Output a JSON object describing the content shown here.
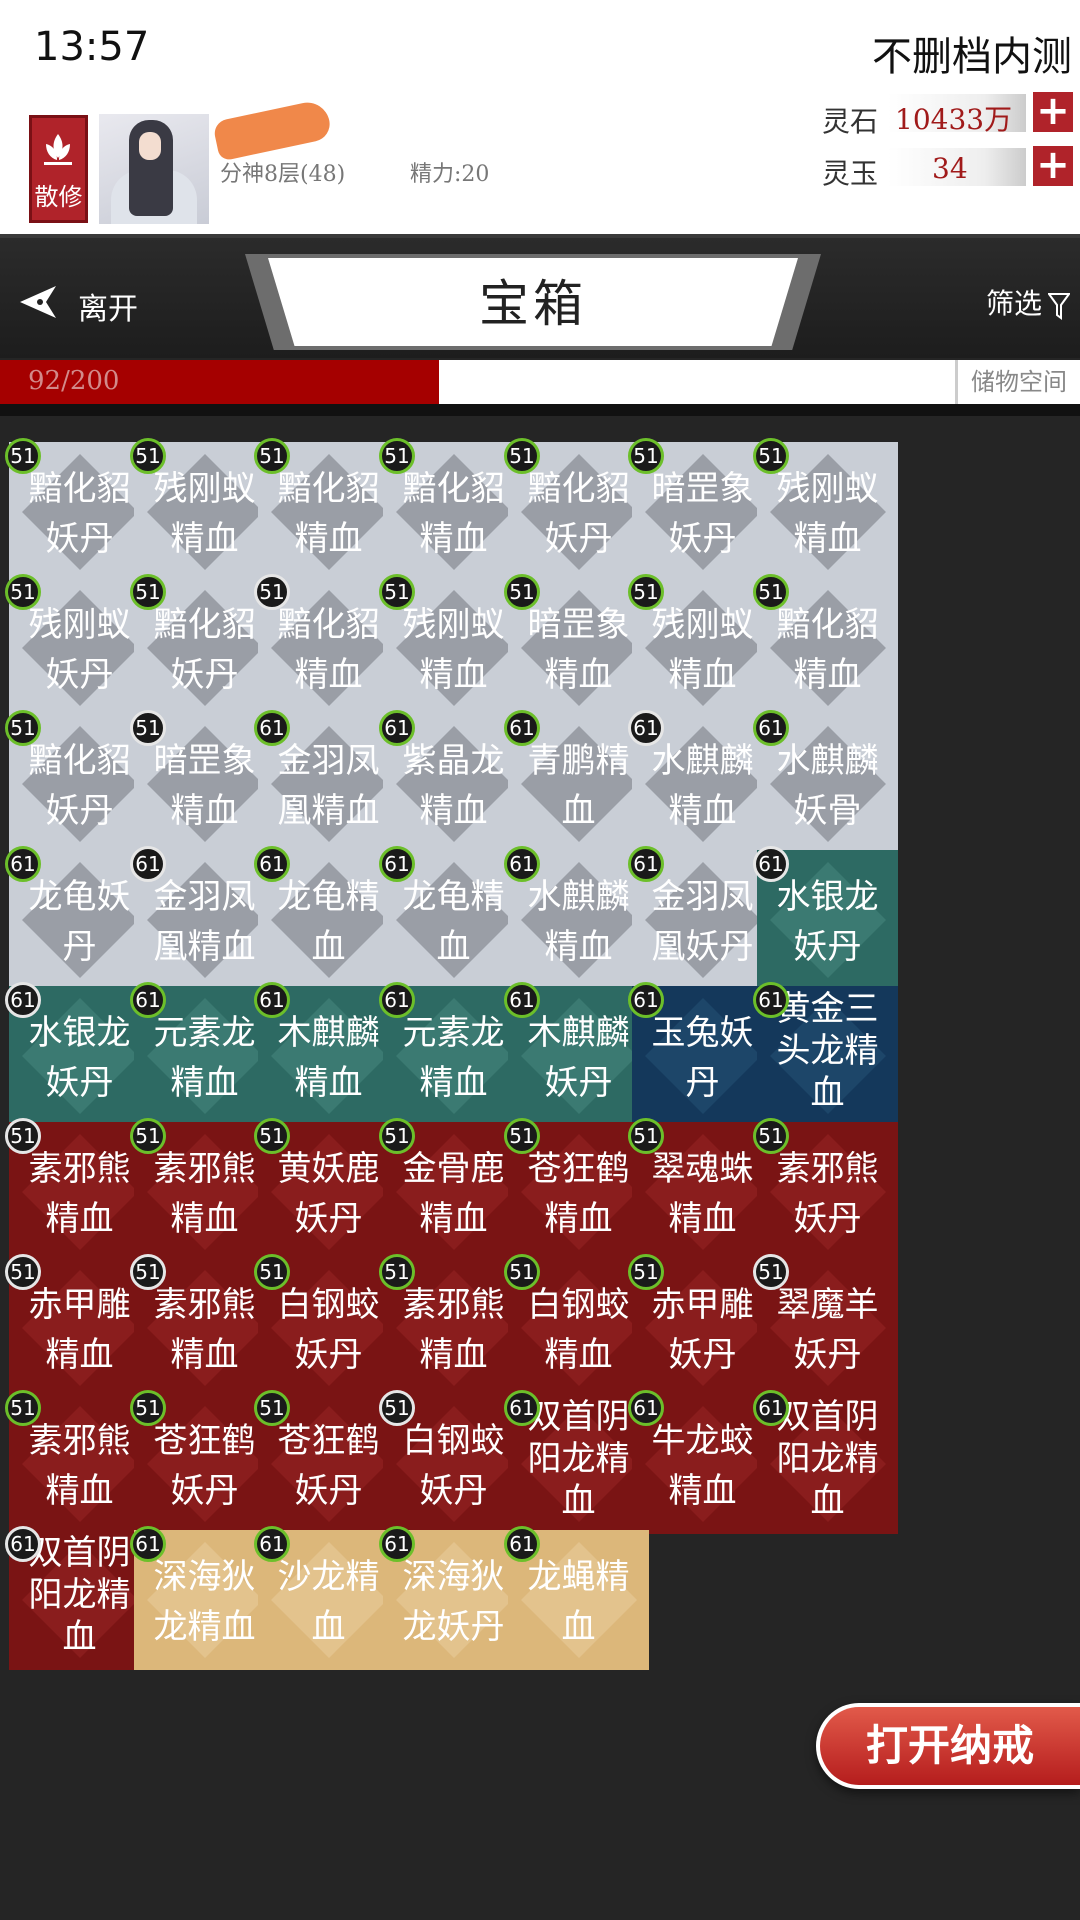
{
  "status_bar": {
    "time": "13:57",
    "build_label": "不删档内测"
  },
  "player": {
    "sect_label": "散修",
    "realm": "分神8层(48)",
    "energy": "精力:20"
  },
  "currencies": [
    {
      "label": "灵石",
      "value": "10433万"
    },
    {
      "label": "灵玉",
      "value": "34"
    }
  ],
  "nav": {
    "leave_label": "离开",
    "title": "宝箱",
    "filter_label": "筛选"
  },
  "capacity": {
    "text": "92/200",
    "used": 92,
    "max": 200,
    "storage_label": "储物空间"
  },
  "items": [
    {
      "name": "黯化貂妖丹",
      "level": "51",
      "rarity": "gray",
      "ring": "green"
    },
    {
      "name": "残刚蚁精血",
      "level": "51",
      "rarity": "gray",
      "ring": "green"
    },
    {
      "name": "黯化貂精血",
      "level": "51",
      "rarity": "gray",
      "ring": "green"
    },
    {
      "name": "黯化貂精血",
      "level": "51",
      "rarity": "gray",
      "ring": "green"
    },
    {
      "name": "黯化貂妖丹",
      "level": "51",
      "rarity": "gray",
      "ring": "green"
    },
    {
      "name": "暗罡象妖丹",
      "level": "51",
      "rarity": "gray",
      "ring": "green"
    },
    {
      "name": "残刚蚁精血",
      "level": "51",
      "rarity": "gray",
      "ring": "green"
    },
    {
      "name": "残刚蚁妖丹",
      "level": "51",
      "rarity": "gray",
      "ring": "green"
    },
    {
      "name": "黯化貂妖丹",
      "level": "51",
      "rarity": "gray",
      "ring": "green"
    },
    {
      "name": "黯化貂精血",
      "level": "51",
      "rarity": "gray",
      "ring": "white"
    },
    {
      "name": "残刚蚁精血",
      "level": "51",
      "rarity": "gray",
      "ring": "green"
    },
    {
      "name": "暗罡象精血",
      "level": "51",
      "rarity": "gray",
      "ring": "green"
    },
    {
      "name": "残刚蚁精血",
      "level": "51",
      "rarity": "gray",
      "ring": "green"
    },
    {
      "name": "黯化貂精血",
      "level": "51",
      "rarity": "gray",
      "ring": "green"
    },
    {
      "name": "黯化貂妖丹",
      "level": "51",
      "rarity": "gray",
      "ring": "green"
    },
    {
      "name": "暗罡象精血",
      "level": "51",
      "rarity": "gray",
      "ring": "white"
    },
    {
      "name": "金羽凤凰精血",
      "level": "61",
      "rarity": "gray",
      "ring": "green"
    },
    {
      "name": "紫晶龙精血",
      "level": "61",
      "rarity": "gray",
      "ring": "green"
    },
    {
      "name": "青鹏精血",
      "level": "61",
      "rarity": "gray",
      "ring": "green"
    },
    {
      "name": "水麒麟精血",
      "level": "61",
      "rarity": "gray",
      "ring": "white"
    },
    {
      "name": "水麒麟妖骨",
      "level": "61",
      "rarity": "gray",
      "ring": "green"
    },
    {
      "name": "龙龟妖丹",
      "level": "61",
      "rarity": "gray",
      "ring": "green"
    },
    {
      "name": "金羽凤凰精血",
      "level": "61",
      "rarity": "gray",
      "ring": "white"
    },
    {
      "name": "龙龟精血",
      "level": "61",
      "rarity": "gray",
      "ring": "green"
    },
    {
      "name": "龙龟精血",
      "level": "61",
      "rarity": "gray",
      "ring": "green"
    },
    {
      "name": "水麒麟精血",
      "level": "61",
      "rarity": "gray",
      "ring": "green"
    },
    {
      "name": "金羽凤凰妖丹",
      "level": "61",
      "rarity": "gray",
      "ring": "green"
    },
    {
      "name": "水银龙妖丹",
      "level": "61",
      "rarity": "teal",
      "ring": "white"
    },
    {
      "name": "水银龙妖丹",
      "level": "61",
      "rarity": "teal",
      "ring": "white"
    },
    {
      "name": "元素龙精血",
      "level": "61",
      "rarity": "teal",
      "ring": "green"
    },
    {
      "name": "木麒麟精血",
      "level": "61",
      "rarity": "teal",
      "ring": "green"
    },
    {
      "name": "元素龙精血",
      "level": "61",
      "rarity": "teal",
      "ring": "green"
    },
    {
      "name": "木麒麟妖丹",
      "level": "61",
      "rarity": "teal",
      "ring": "green"
    },
    {
      "name": "玉兔妖丹",
      "level": "61",
      "rarity": "navy",
      "ring": "green"
    },
    {
      "name": "黄金三头龙精血",
      "level": "61",
      "rarity": "navy",
      "ring": "green"
    },
    {
      "name": "素邪熊精血",
      "level": "51",
      "rarity": "red",
      "ring": "white"
    },
    {
      "name": "素邪熊精血",
      "level": "51",
      "rarity": "red",
      "ring": "green"
    },
    {
      "name": "黄妖鹿妖丹",
      "level": "51",
      "rarity": "red",
      "ring": "green"
    },
    {
      "name": "金骨鹿精血",
      "level": "51",
      "rarity": "red",
      "ring": "green"
    },
    {
      "name": "苍狂鹤精血",
      "level": "51",
      "rarity": "red",
      "ring": "green"
    },
    {
      "name": "翠魂蛛精血",
      "level": "51",
      "rarity": "red",
      "ring": "green"
    },
    {
      "name": "素邪熊妖丹",
      "level": "51",
      "rarity": "red",
      "ring": "green"
    },
    {
      "name": "赤甲雕精血",
      "level": "51",
      "rarity": "red",
      "ring": "white"
    },
    {
      "name": "素邪熊精血",
      "level": "51",
      "rarity": "red",
      "ring": "white"
    },
    {
      "name": "白钢蛟妖丹",
      "level": "51",
      "rarity": "red",
      "ring": "green"
    },
    {
      "name": "素邪熊精血",
      "level": "51",
      "rarity": "red",
      "ring": "green"
    },
    {
      "name": "白钢蛟精血",
      "level": "51",
      "rarity": "red",
      "ring": "green"
    },
    {
      "name": "赤甲雕妖丹",
      "level": "51",
      "rarity": "red",
      "ring": "green"
    },
    {
      "name": "翠魔羊妖丹",
      "level": "51",
      "rarity": "red",
      "ring": "white"
    },
    {
      "name": "素邪熊精血",
      "level": "51",
      "rarity": "red",
      "ring": "green"
    },
    {
      "name": "苍狂鹤妖丹",
      "level": "51",
      "rarity": "red",
      "ring": "green"
    },
    {
      "name": "苍狂鹤妖丹",
      "level": "51",
      "rarity": "red",
      "ring": "green"
    },
    {
      "name": "白钢蛟妖丹",
      "level": "51",
      "rarity": "red",
      "ring": "white"
    },
    {
      "name": "双首阴阳龙精血",
      "level": "61",
      "rarity": "red",
      "ring": "green"
    },
    {
      "name": "牛龙蛟精血",
      "level": "61",
      "rarity": "red",
      "ring": "green"
    },
    {
      "name": "双首阴阳龙精血",
      "level": "61",
      "rarity": "red",
      "ring": "green"
    },
    {
      "name": "双首阴阳龙精血",
      "level": "61",
      "rarity": "red",
      "ring": "white"
    },
    {
      "name": "深海狄龙精血",
      "level": "61",
      "rarity": "gold",
      "ring": "green"
    },
    {
      "name": "沙龙精血",
      "level": "61",
      "rarity": "gold",
      "ring": "green"
    },
    {
      "name": "深海狄龙妖丹",
      "level": "61",
      "rarity": "gold",
      "ring": "green"
    },
    {
      "name": "龙蝇精血",
      "level": "61",
      "rarity": "gold",
      "ring": "green"
    }
  ],
  "open_ring_label": "打开纳戒",
  "colors": {
    "accent_red": "#b0232a",
    "capacity_fill": "#a50000"
  }
}
